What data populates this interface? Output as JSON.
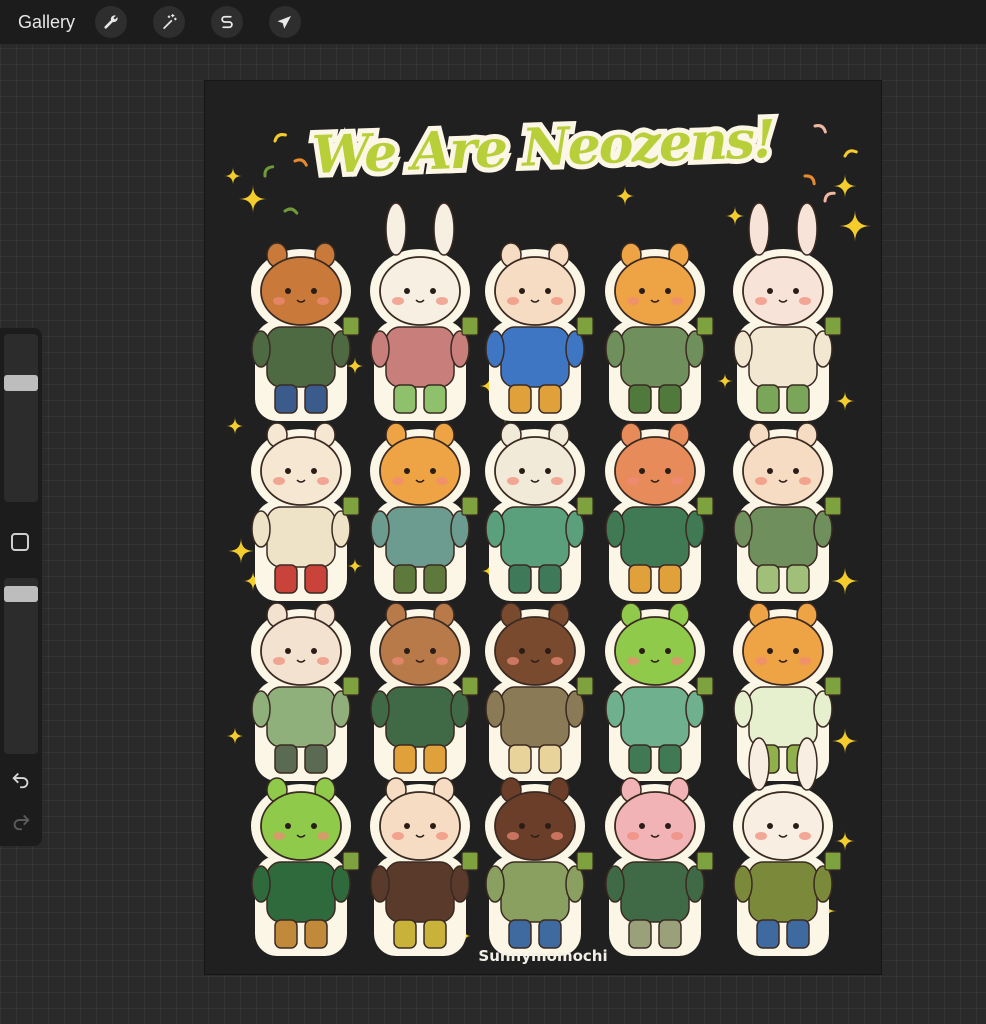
{
  "toolbar": {
    "gallery_label": "Gallery",
    "tools": [
      {
        "name": "actions",
        "icon": "wrench-icon"
      },
      {
        "name": "adjustments",
        "icon": "magic-wand-icon"
      },
      {
        "name": "selection",
        "icon": "selection-s-icon"
      },
      {
        "name": "transform",
        "icon": "arrow-cursor-icon"
      }
    ]
  },
  "sidebar": {
    "brush_size_level": 0.27,
    "opacity_level": 0.05,
    "icons": [
      "modify-square-icon",
      "undo-icon",
      "redo-icon"
    ]
  },
  "artwork": {
    "title": "We Are Neozens!",
    "signature": "Sunnymomochi",
    "title_color": "#b8cf3a",
    "accent_colors": [
      "#f4cc2b",
      "#e78a2e",
      "#6f9a3a",
      "#f0b8a2"
    ],
    "characters": [
      {
        "row": 1,
        "col": 1,
        "animal": "bear",
        "head": "#c9793a",
        "outfit": "#4d6a43",
        "accent": "#3b5b8c"
      },
      {
        "row": 1,
        "col": 2,
        "animal": "bunny",
        "head": "#f6efe2",
        "outfit": "#c87e7a",
        "accent": "#8fc06b"
      },
      {
        "row": 1,
        "col": 3,
        "animal": "cat",
        "head": "#f6dcc3",
        "outfit": "#3f76c4",
        "accent": "#e0a03a"
      },
      {
        "row": 1,
        "col": 4,
        "animal": "tiger",
        "head": "#eea444",
        "outfit": "#6f8f5c",
        "accent": "#4f7a3c"
      },
      {
        "row": 1,
        "col": 5,
        "animal": "bunny",
        "head": "#f8e3d8",
        "outfit": "#f2e8d2",
        "accent": "#7aa65a"
      },
      {
        "row": 2,
        "col": 1,
        "animal": "cat",
        "head": "#f6e7d2",
        "outfit": "#efe3c7",
        "accent": "#c9433a"
      },
      {
        "row": 2,
        "col": 2,
        "animal": "tiger",
        "head": "#eea444",
        "outfit": "#6b9c8f",
        "accent": "#5d7a3c"
      },
      {
        "row": 2,
        "col": 3,
        "animal": "mouse",
        "head": "#f2ead8",
        "outfit": "#5aa07c",
        "accent": "#3e7a5a"
      },
      {
        "row": 2,
        "col": 4,
        "animal": "bear",
        "head": "#e88b5a",
        "outfit": "#3f7a55",
        "accent": "#e0a03a"
      },
      {
        "row": 2,
        "col": 5,
        "animal": "cat",
        "head": "#f6dcc3",
        "outfit": "#6f8f5c",
        "accent": "#a0c07a"
      },
      {
        "row": 3,
        "col": 1,
        "animal": "bear",
        "head": "#f2e2cf",
        "outfit": "#8fb07a",
        "accent": "#5b6a52"
      },
      {
        "row": 3,
        "col": 2,
        "animal": "bear",
        "head": "#b97a4a",
        "outfit": "#3f6a45",
        "accent": "#e0a03a"
      },
      {
        "row": 3,
        "col": 3,
        "animal": "squirrel",
        "head": "#7a4a2e",
        "outfit": "#8a7a55",
        "accent": "#e8d49a"
      },
      {
        "row": 3,
        "col": 4,
        "animal": "frog",
        "head": "#8fca4a",
        "outfit": "#6fb08f",
        "accent": "#3f7a55"
      },
      {
        "row": 3,
        "col": 5,
        "animal": "tiger",
        "head": "#eea444",
        "outfit": "#e6f0cf",
        "accent": "#8fb04a"
      },
      {
        "row": 4,
        "col": 1,
        "animal": "frog",
        "head": "#8fca4a",
        "outfit": "#2f6a3c",
        "accent": "#c08a3a"
      },
      {
        "row": 4,
        "col": 2,
        "animal": "cat",
        "head": "#f6dcc3",
        "outfit": "#5a3a2a",
        "accent": "#c9b23a"
      },
      {
        "row": 4,
        "col": 3,
        "animal": "cat",
        "head": "#6a3e28",
        "outfit": "#8aa060",
        "accent": "#3f6aa0"
      },
      {
        "row": 4,
        "col": 4,
        "animal": "pig",
        "head": "#f1b3b5",
        "outfit": "#3f6a45",
        "accent": "#9aa07a"
      },
      {
        "row": 4,
        "col": 5,
        "animal": "bunny",
        "head": "#f8eee2",
        "outfit": "#7a8a3a",
        "accent": "#3f6aa0"
      }
    ]
  }
}
